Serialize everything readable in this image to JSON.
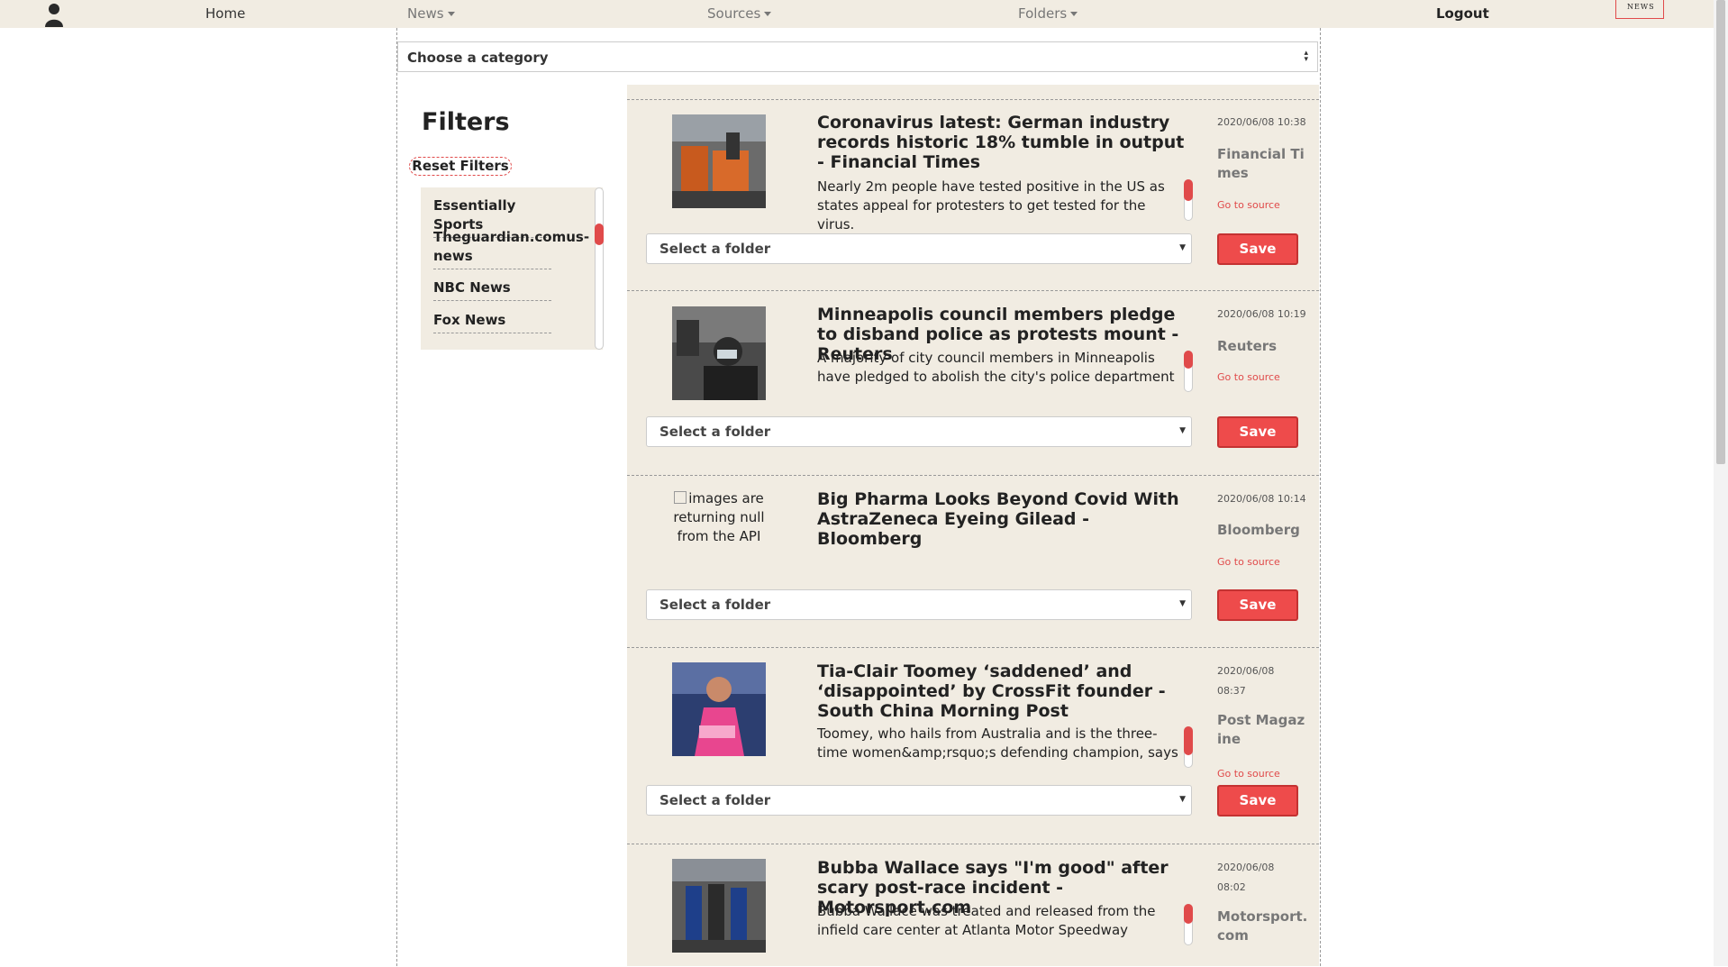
{
  "nav": {
    "home": "Home",
    "news": "News",
    "sources": "Sources",
    "folders": "Folders",
    "logout": "Logout",
    "brand": "NEWS",
    "logo_icon": "avatar-icon"
  },
  "category_select": {
    "value": "Choose a category"
  },
  "filters": {
    "title": "Filters",
    "reset_label": "Reset Filters",
    "sources": [
      "Essentially Sports",
      "Theguardian.comus-news",
      "NBC News",
      "Fox News"
    ]
  },
  "articles": [
    {
      "title": "Coronavirus latest: German industry records historic 18% tumble in output - Financial Times",
      "description": "Nearly 2m people have tested positive in the US as states appeal for protesters to get tested for the virus.",
      "date": "2020/06/08 10:38",
      "source": "Financial Times",
      "go_to_source": "Go to source",
      "folder_placeholder": "Select a folder",
      "save_label": "Save",
      "image_alt": ""
    },
    {
      "title": "Minneapolis council members pledge to disband police as protests mount - Reuters",
      "description": "A majority of city council members in Minneapolis have pledged to abolish the city's police department",
      "date": "2020/06/08 10:19",
      "source": "Reuters",
      "go_to_source": "Go to source",
      "folder_placeholder": "Select a folder",
      "save_label": "Save",
      "image_alt": ""
    },
    {
      "title": "Big Pharma Looks Beyond Covid With AstraZeneca Eyeing Gilead - Bloomberg",
      "description": "",
      "date": "2020/06/08 10:14",
      "source": "Bloomberg",
      "go_to_source": "Go to source",
      "folder_placeholder": "Select a folder",
      "save_label": "Save",
      "image_alt": "images are returning null from the API"
    },
    {
      "title": "Tia-Clair Toomey ‘saddened’ and ‘disappointed’ by CrossFit founder - South China Morning Post",
      "description": "Toomey, who hails from Australia and is the three-time women&amp;rsquo;s defending champion, says",
      "date": "2020/06/08 08:37",
      "source": "Post Magazine",
      "go_to_source": "Go to source",
      "folder_placeholder": "Select a folder",
      "save_label": "Save",
      "image_alt": ""
    },
    {
      "title": "Bubba Wallace says \"I'm good\" after scary post-race incident - Motorsport.com",
      "description": "Bubba Wallace was treated and released from the infield care center at Atlanta Motor Speedway",
      "date": "2020/06/08 08:02",
      "source": "Motorsport.com",
      "go_to_source": "",
      "folder_placeholder": "",
      "save_label": "",
      "image_alt": ""
    }
  ],
  "colors": {
    "accent": "#ee4b4b",
    "panel_bg": "#f1ece2"
  }
}
